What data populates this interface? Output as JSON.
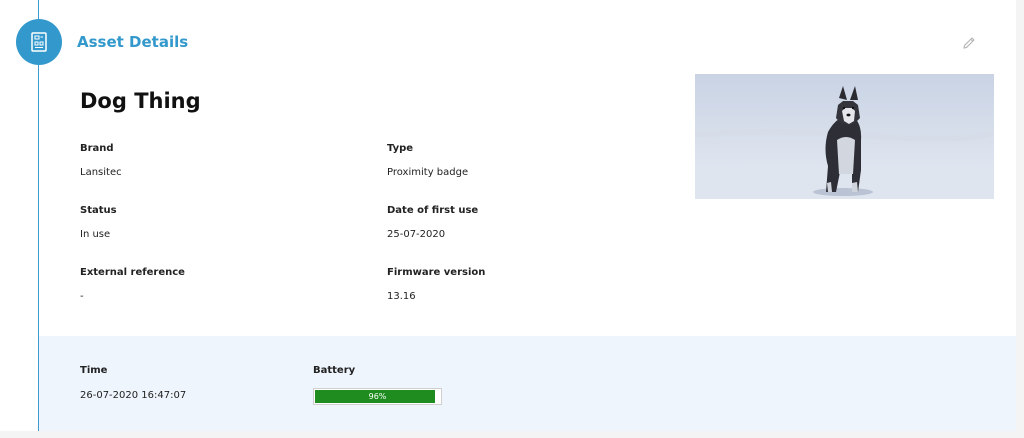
{
  "header": {
    "title": "Asset Details",
    "icon": "asset-document-icon",
    "edit_icon": "pencil-icon"
  },
  "asset": {
    "name": "Dog Thing",
    "photo": "husky-dog-in-snow"
  },
  "fields": {
    "brand": {
      "label": "Brand",
      "value": "Lansitec"
    },
    "type": {
      "label": "Type",
      "value": "Proximity badge"
    },
    "status": {
      "label": "Status",
      "value": "In use"
    },
    "first_use": {
      "label": "Date of first use",
      "value": "25-07-2020"
    },
    "external_ref": {
      "label": "External reference",
      "value": "-"
    },
    "firmware": {
      "label": "Firmware version",
      "value": "13.16"
    }
  },
  "status_panel": {
    "time_label": "Time",
    "time_value": "26-07-2020 16:47:07",
    "battery_label": "Battery",
    "battery_text": "96%",
    "battery_level": 0.96
  },
  "colors": {
    "accent": "#3399cc",
    "battery": "#1e8c1e",
    "panel_bg": "#eef5fc"
  }
}
